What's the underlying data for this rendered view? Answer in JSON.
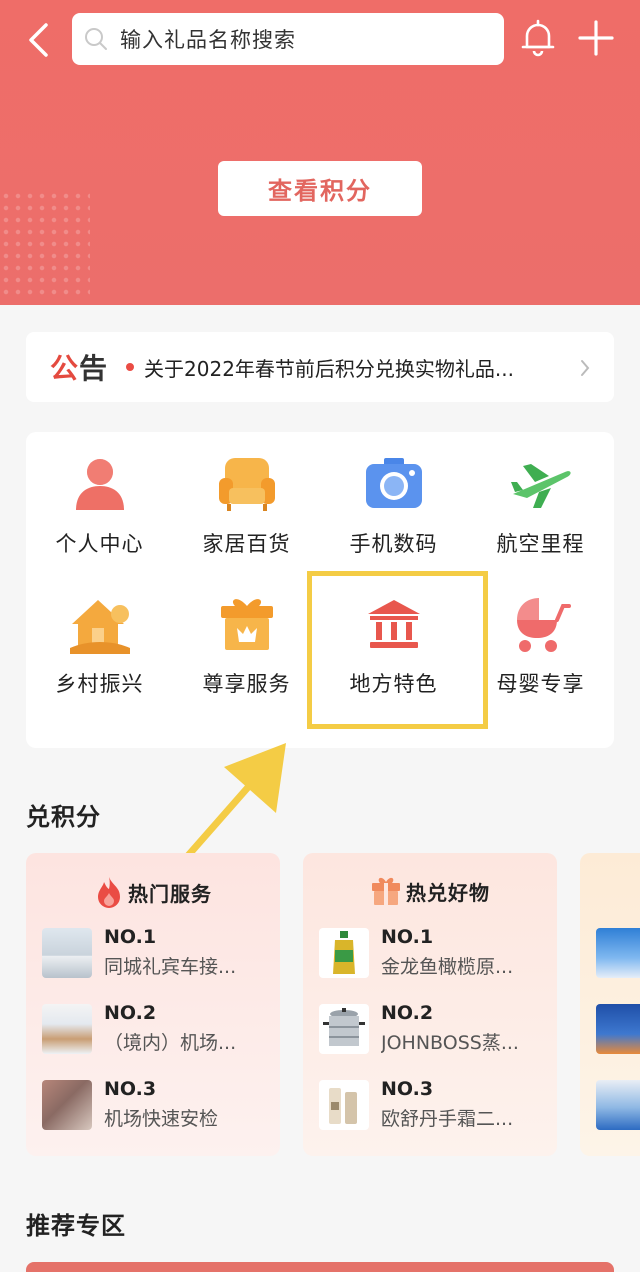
{
  "header": {
    "search_placeholder": "输入礼品名称搜索",
    "points_button": "查看积分"
  },
  "notice": {
    "tag": "公告",
    "text": "关于2022年春节前后积分兑换实物礼品..."
  },
  "categories": [
    {
      "label": "个人中心",
      "icon": "person-icon"
    },
    {
      "label": "家居百货",
      "icon": "sofa-icon"
    },
    {
      "label": "手机数码",
      "icon": "camera-icon"
    },
    {
      "label": "航空里程",
      "icon": "airplane-icon"
    },
    {
      "label": "乡村振兴",
      "icon": "rural-house-icon"
    },
    {
      "label": "尊享服务",
      "icon": "gift-box-icon"
    },
    {
      "label": "地方特色",
      "icon": "landmark-icon"
    },
    {
      "label": "母婴专享",
      "icon": "stroller-icon"
    }
  ],
  "redeem": {
    "title": "兑积分",
    "hot_services": {
      "title": "热门服务",
      "items": [
        {
          "rank": "NO.1",
          "name": "同城礼宾车接..."
        },
        {
          "rank": "NO.2",
          "name": "（境内）机场..."
        },
        {
          "rank": "NO.3",
          "name": "机场快速安检"
        }
      ]
    },
    "hot_goods": {
      "title": "热兑好物",
      "items": [
        {
          "rank": "NO.1",
          "name": "金龙鱼橄榄原..."
        },
        {
          "rank": "NO.2",
          "name": "JOHNBOSS蒸..."
        },
        {
          "rank": "NO.3",
          "name": "欧舒丹手霜二..."
        }
      ]
    }
  },
  "recommend": {
    "title": "推荐专区"
  },
  "colors": {
    "header_red": "#ec6e6b",
    "accent_red": "#e2665f",
    "highlight_yellow": "#f4cc45"
  }
}
